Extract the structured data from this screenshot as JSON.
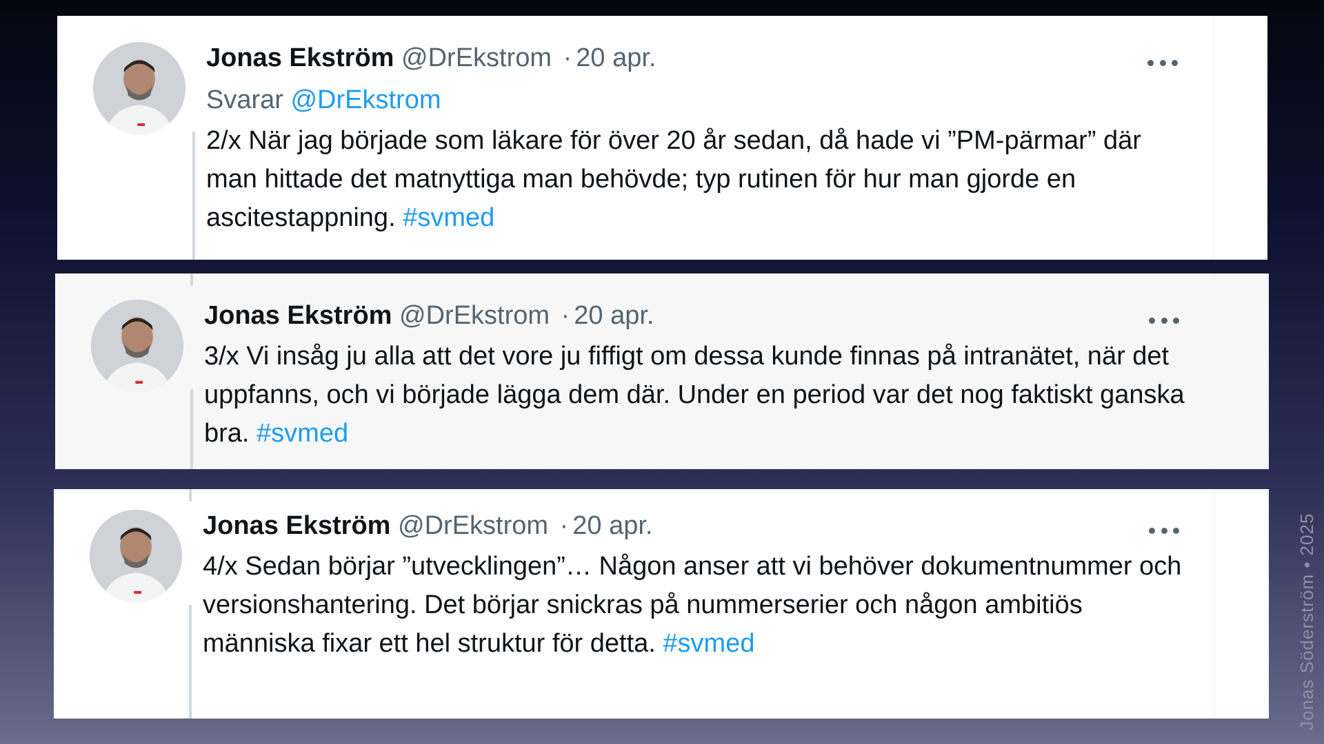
{
  "tweets": [
    {
      "name": "Jonas Ekström",
      "handle": "@DrEkstrom",
      "separator": "·",
      "date": "20 apr.",
      "reply_prefix": "Svarar",
      "reply_handle": "@DrEkstrom",
      "text": "2/x När jag började som läkare för över 20 år sedan, då hade vi ”PM-pärmar” där man hittade det matnyttiga man behövde; typ rutinen för hur man gjorde en ascitestappning. ",
      "hashtag": "#svmed",
      "more_icon": "ellipsis-icon"
    },
    {
      "name": "Jonas Ekström",
      "handle": "@DrEkstrom",
      "separator": "·",
      "date": "20 apr.",
      "text": "3/x Vi insåg ju alla att det vore ju fiffigt om dessa kunde finnas på intranätet, när det uppfanns, och vi började lägga dem där. Under en period var det nog faktiskt ganska bra. ",
      "hashtag": "#svmed",
      "more_icon": "ellipsis-icon"
    },
    {
      "name": "Jonas Ekström",
      "handle": "@DrEkstrom",
      "separator": "·",
      "date": "20 apr.",
      "text": "4/x Sedan börjar ”utvecklingen”… Någon anser att vi behöver dokumentnummer och versionshantering. Det börjar snickras på nummerserier och någon ambitiös människa fixar ett hel struktur för detta. ",
      "hashtag": "#svmed",
      "more_icon": "ellipsis-icon"
    }
  ],
  "watermark": "Jonas Söderström • 2025",
  "colors": {
    "link": "#1d9bf0",
    "secondary_text": "#536471",
    "primary_text": "#0f1419",
    "thread_line": "#cfd9de"
  }
}
